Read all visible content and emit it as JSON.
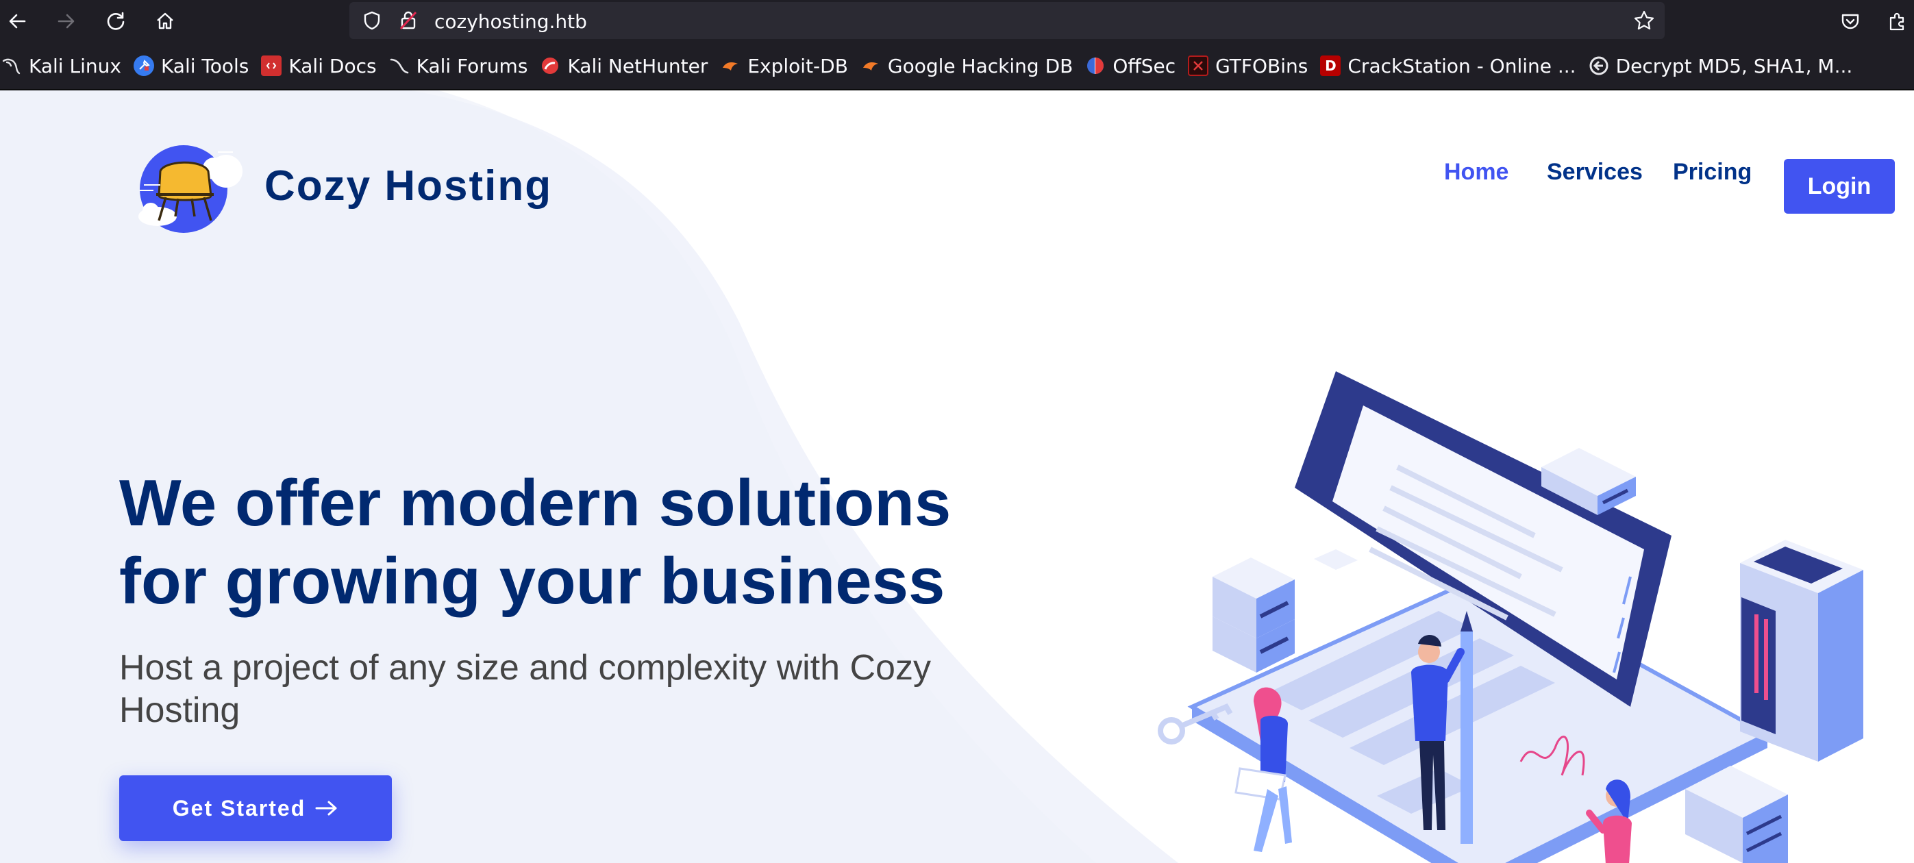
{
  "browser": {
    "url": "cozyhosting.htb",
    "bookmarks": [
      {
        "label": "Kali Linux",
        "icon": "kali-dragon-icon"
      },
      {
        "label": "Kali Tools",
        "icon": "kali-tools-icon"
      },
      {
        "label": "Kali Docs",
        "icon": "kali-docs-icon"
      },
      {
        "label": "Kali Forums",
        "icon": "kali-forums-icon"
      },
      {
        "label": "Kali NetHunter",
        "icon": "nethunter-icon"
      },
      {
        "label": "Exploit-DB",
        "icon": "exploit-db-icon"
      },
      {
        "label": "Google Hacking DB",
        "icon": "ghdb-icon"
      },
      {
        "label": "OffSec",
        "icon": "offsec-icon"
      },
      {
        "label": "GTFOBins",
        "icon": "gtfobins-icon"
      },
      {
        "label": "CrackStation - Online ...",
        "icon": "crackstation-icon"
      },
      {
        "label": "Decrypt MD5, SHA1, M...",
        "icon": "decrypt-icon"
      }
    ]
  },
  "header": {
    "brand": "Cozy Hosting",
    "nav": [
      {
        "label": "Home",
        "active": true
      },
      {
        "label": "Services",
        "active": false
      },
      {
        "label": "Pricing",
        "active": false
      }
    ],
    "login_label": "Login"
  },
  "hero": {
    "headline_line1": "We offer modern solutions",
    "headline_line2": "for growing your business",
    "subtitle": "Host a project of any size and complexity with Cozy Hosting",
    "cta_label": "Get Started",
    "cta_icon": "arrow-right-icon"
  },
  "colors": {
    "accent": "#4154f1",
    "heading": "#012970",
    "chrome_bg": "#1f1e25",
    "urlbar_bg": "#2b2a33"
  }
}
